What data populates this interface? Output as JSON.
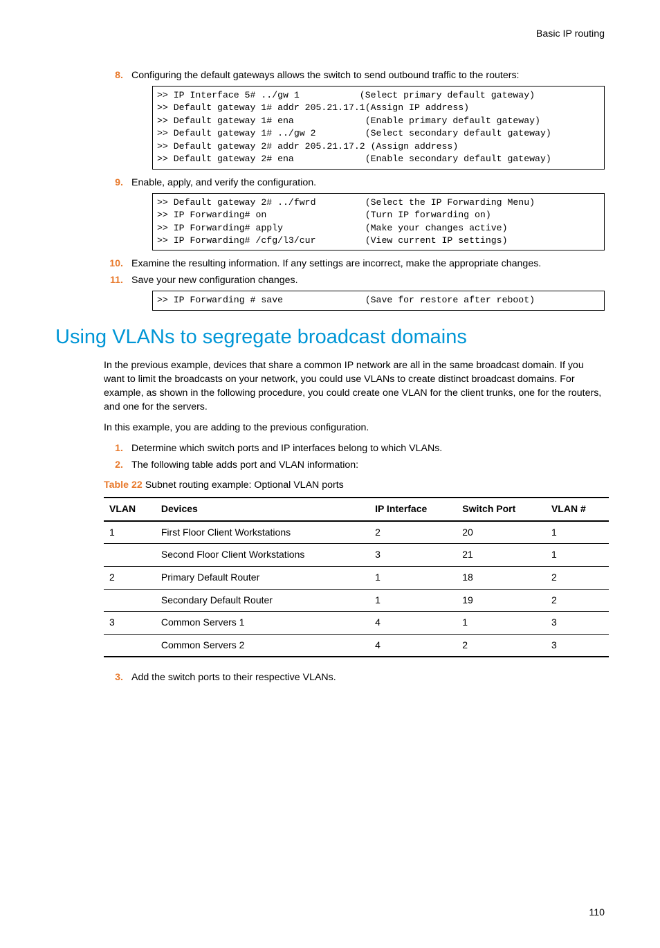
{
  "header": {
    "right": "Basic IP routing"
  },
  "footer": {
    "page": "110"
  },
  "steps_a": [
    {
      "num": "8.",
      "text": "Configuring the default gateways allows the switch to send outbound traffic to the routers:"
    },
    {
      "num": "9.",
      "text": "Enable, apply, and verify the configuration."
    },
    {
      "num": "10.",
      "text": "Examine the resulting information. If any settings are incorrect, make the appropriate changes."
    },
    {
      "num": "11.",
      "text": "Save your new configuration changes."
    }
  ],
  "code8": ">> IP Interface 5# ../gw 1           (Select primary default gateway)\n>> Default gateway 1# addr 205.21.17.1(Assign IP address)\n>> Default gateway 1# ena             (Enable primary default gateway)\n>> Default gateway 1# ../gw 2         (Select secondary default gateway)\n>> Default gateway 2# addr 205.21.17.2 (Assign address)\n>> Default gateway 2# ena             (Enable secondary default gateway)",
  "code9": ">> Default gateway 2# ../fwrd         (Select the IP Forwarding Menu)\n>> IP Forwarding# on                  (Turn IP forwarding on)\n>> IP Forwarding# apply               (Make your changes active)\n>> IP Forwarding# /cfg/l3/cur         (View current IP settings)",
  "code11": ">> IP Forwarding # save               (Save for restore after reboot)",
  "section_title": "Using VLANs to segregate broadcast domains",
  "para1": "In the previous example, devices that share a common IP network are all in the same broadcast domain. If you want to limit the broadcasts on your network, you could use VLANs to create distinct broadcast domains. For example, as shown in the following procedure, you could create one VLAN for the client trunks, one for the routers, and one for the servers.",
  "para2": "In this example, you are adding to the previous configuration.",
  "steps_b": [
    {
      "num": "1.",
      "text": "Determine which switch ports and IP interfaces belong to which VLANs."
    },
    {
      "num": "2.",
      "text": "The following table adds port and VLAN information:"
    }
  ],
  "table": {
    "label": "Table 22",
    "caption": "Subnet routing example: Optional VLAN ports",
    "headers": [
      "VLAN",
      "Devices",
      "IP Interface",
      "Switch Port",
      "VLAN #"
    ],
    "rows": [
      [
        "1",
        "First Floor Client Workstations",
        "2",
        "20",
        "1"
      ],
      [
        "",
        "Second Floor Client Workstations",
        "3",
        "21",
        "1"
      ],
      [
        "2",
        "Primary Default Router",
        "1",
        "18",
        "2"
      ],
      [
        "",
        "Secondary Default Router",
        "1",
        "19",
        "2"
      ],
      [
        "3",
        "Common Servers 1",
        "4",
        "1",
        "3"
      ],
      [
        "",
        "Common Servers 2",
        "4",
        "2",
        "3"
      ]
    ]
  },
  "steps_c": [
    {
      "num": "3.",
      "text": "Add the switch ports to their respective VLANs."
    }
  ],
  "chart_data": {
    "type": "table",
    "title": "Subnet routing example: Optional VLAN ports",
    "columns": [
      "VLAN",
      "Devices",
      "IP Interface",
      "Switch Port",
      "VLAN #"
    ],
    "rows": [
      [
        "1",
        "First Floor Client Workstations",
        "2",
        "20",
        "1"
      ],
      [
        "",
        "Second Floor Client Workstations",
        "3",
        "21",
        "1"
      ],
      [
        "2",
        "Primary Default Router",
        "1",
        "18",
        "2"
      ],
      [
        "",
        "Secondary Default Router",
        "1",
        "19",
        "2"
      ],
      [
        "3",
        "Common Servers 1",
        "4",
        "1",
        "3"
      ],
      [
        "",
        "Common Servers 2",
        "4",
        "2",
        "3"
      ]
    ]
  }
}
